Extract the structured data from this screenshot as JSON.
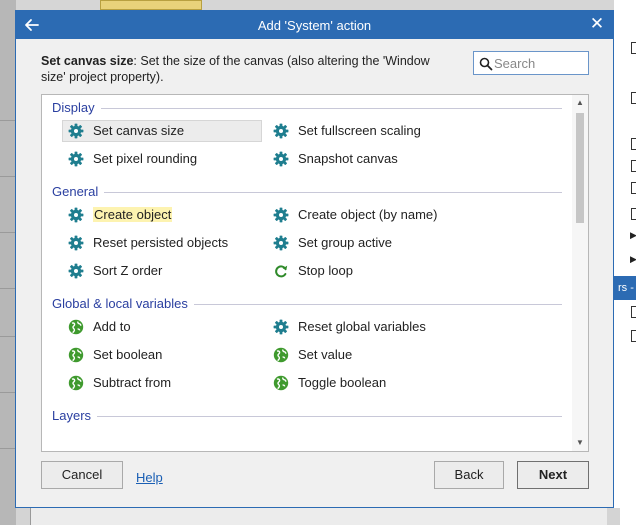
{
  "dialog": {
    "title": "Add 'System' action",
    "description_bold": "Set canvas size",
    "description_rest": ": Set the size of the canvas (also altering the 'Window size' project property).",
    "search_placeholder": "Search",
    "accent": "#2c6bb3"
  },
  "categories": [
    {
      "name": "Display",
      "items": [
        {
          "label": "Set canvas size",
          "icon": "gear-icon",
          "selected": true
        },
        {
          "label": "Set fullscreen scaling",
          "icon": "gear-icon"
        },
        {
          "label": "Set pixel rounding",
          "icon": "gear-icon"
        },
        {
          "label": "Snapshot canvas",
          "icon": "gear-icon"
        }
      ]
    },
    {
      "name": "General",
      "items": [
        {
          "label": "Create object",
          "icon": "gear-icon",
          "highlighted": true
        },
        {
          "label": "Create object (by name)",
          "icon": "gear-icon"
        },
        {
          "label": "Reset persisted objects",
          "icon": "gear-icon"
        },
        {
          "label": "Set group active",
          "icon": "gear-icon"
        },
        {
          "label": "Sort Z order",
          "icon": "gear-icon"
        },
        {
          "label": "Stop loop",
          "icon": "loop-arrow-icon"
        }
      ]
    },
    {
      "name": "Global & local variables",
      "items": [
        {
          "label": "Add to",
          "icon": "globe-icon"
        },
        {
          "label": "Reset global variables",
          "icon": "gear-icon"
        },
        {
          "label": "Set boolean",
          "icon": "globe-icon"
        },
        {
          "label": "Set value",
          "icon": "globe-icon"
        },
        {
          "label": "Subtract from",
          "icon": "globe-icon"
        },
        {
          "label": "Toggle boolean",
          "icon": "globe-icon"
        }
      ]
    },
    {
      "name": "Layers",
      "items": []
    }
  ],
  "buttons": {
    "cancel": "Cancel",
    "help": "Help",
    "back": "Back",
    "next": "Next"
  },
  "background": {
    "right_strip_text": "rs -"
  }
}
